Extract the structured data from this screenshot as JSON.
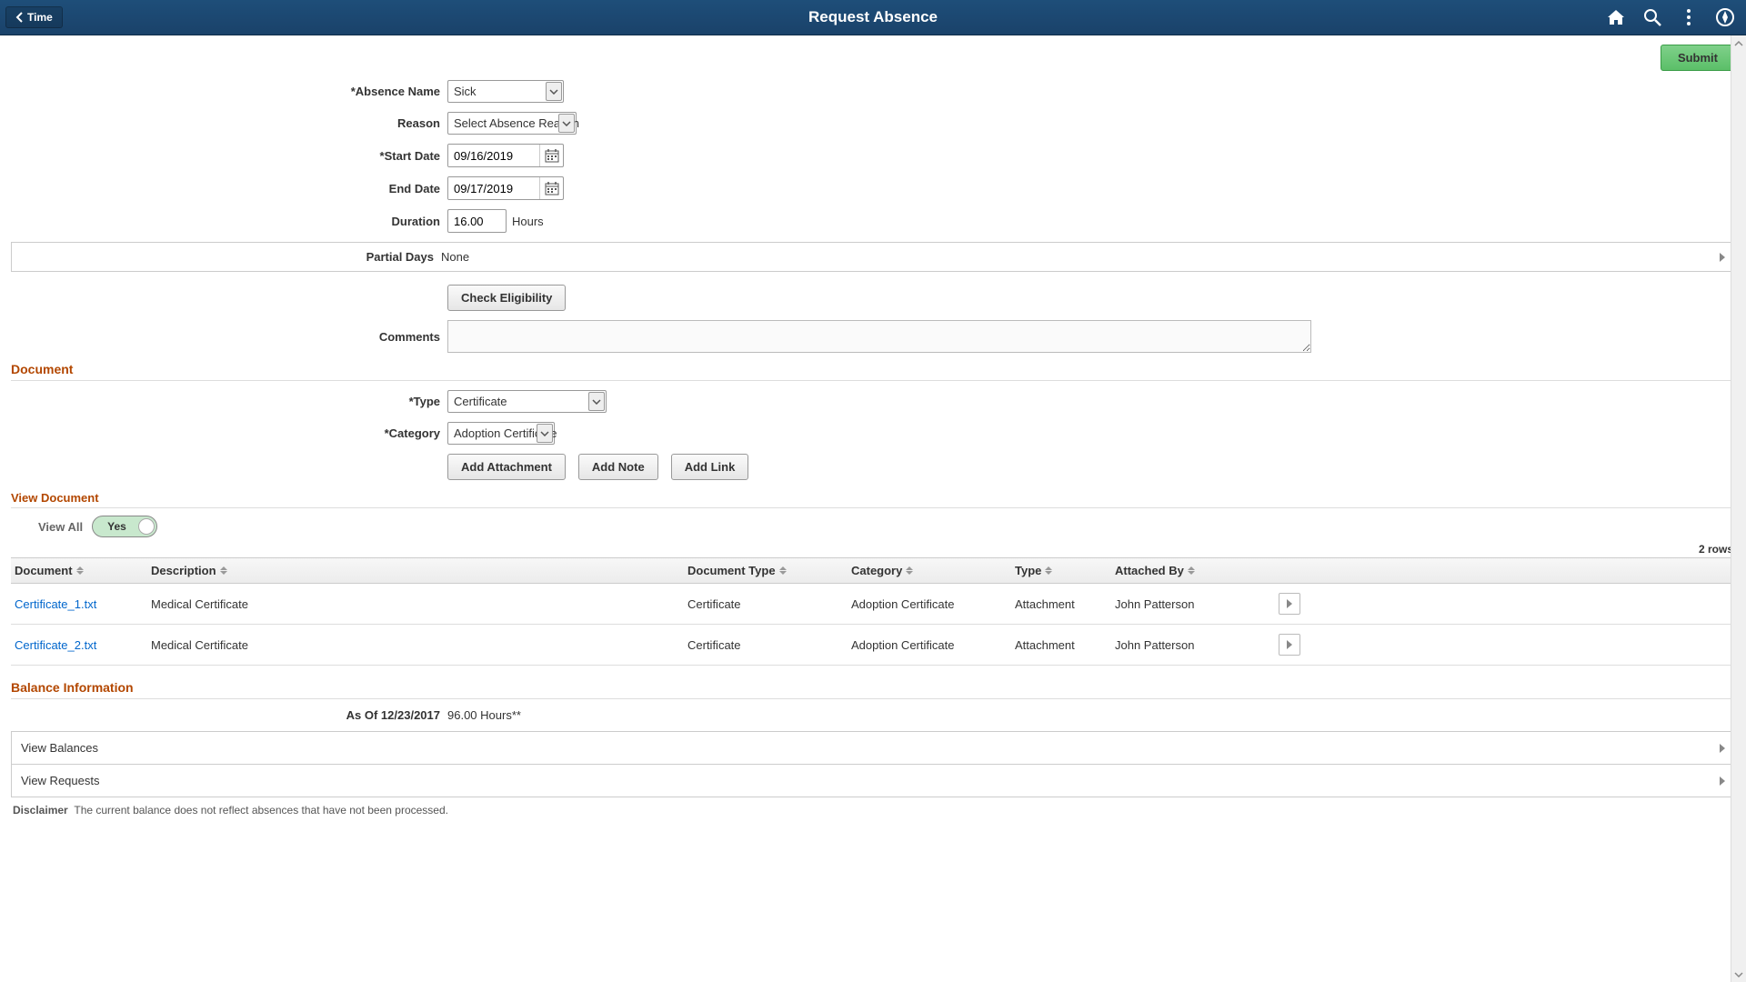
{
  "header": {
    "back_label": "Time",
    "title": "Request Absence"
  },
  "submit": {
    "label": "Submit"
  },
  "form": {
    "absence_name": {
      "label": "*Absence Name",
      "value": "Sick"
    },
    "reason": {
      "label": "Reason",
      "value": "Select Absence Reason"
    },
    "start_date": {
      "label": "*Start Date",
      "value": "09/16/2019"
    },
    "end_date": {
      "label": "End Date",
      "value": "09/17/2019"
    },
    "duration": {
      "label": "Duration",
      "value": "16.00",
      "unit": "Hours"
    },
    "partial_days": {
      "label": "Partial Days",
      "value": "None"
    },
    "check_eligibility": {
      "label": "Check Eligibility"
    },
    "comments": {
      "label": "Comments",
      "value": ""
    }
  },
  "document_section": {
    "title": "Document",
    "type": {
      "label": "*Type",
      "value": "Certificate"
    },
    "category": {
      "label": "*Category",
      "value": "Adoption Certificate"
    },
    "add_attachment": {
      "label": "Add Attachment"
    },
    "add_note": {
      "label": "Add Note"
    },
    "add_link": {
      "label": "Add Link"
    }
  },
  "view_document": {
    "title": "View Document",
    "view_all": {
      "label": "View All",
      "value": "Yes"
    },
    "rows_count": "2 rows",
    "columns": {
      "document": "Document",
      "description": "Description",
      "document_type": "Document Type",
      "category": "Category",
      "type": "Type",
      "attached_by": "Attached By"
    },
    "rows": [
      {
        "document": "Certificate_1.txt",
        "description": "Medical Certificate",
        "document_type": "Certificate",
        "category": "Adoption Certificate",
        "type": "Attachment",
        "attached_by": "John Patterson"
      },
      {
        "document": "Certificate_2.txt",
        "description": "Medical Certificate",
        "document_type": "Certificate",
        "category": "Adoption Certificate",
        "type": "Attachment",
        "attached_by": "John Patterson"
      }
    ]
  },
  "balance": {
    "title": "Balance Information",
    "as_of": {
      "label": "As Of 12/23/2017",
      "value": "96.00 Hours**"
    },
    "view_balances": "View Balances",
    "view_requests": "View Requests"
  },
  "disclaimer": {
    "label": "Disclaimer",
    "text": "The current balance does not reflect absences that have not been processed."
  }
}
